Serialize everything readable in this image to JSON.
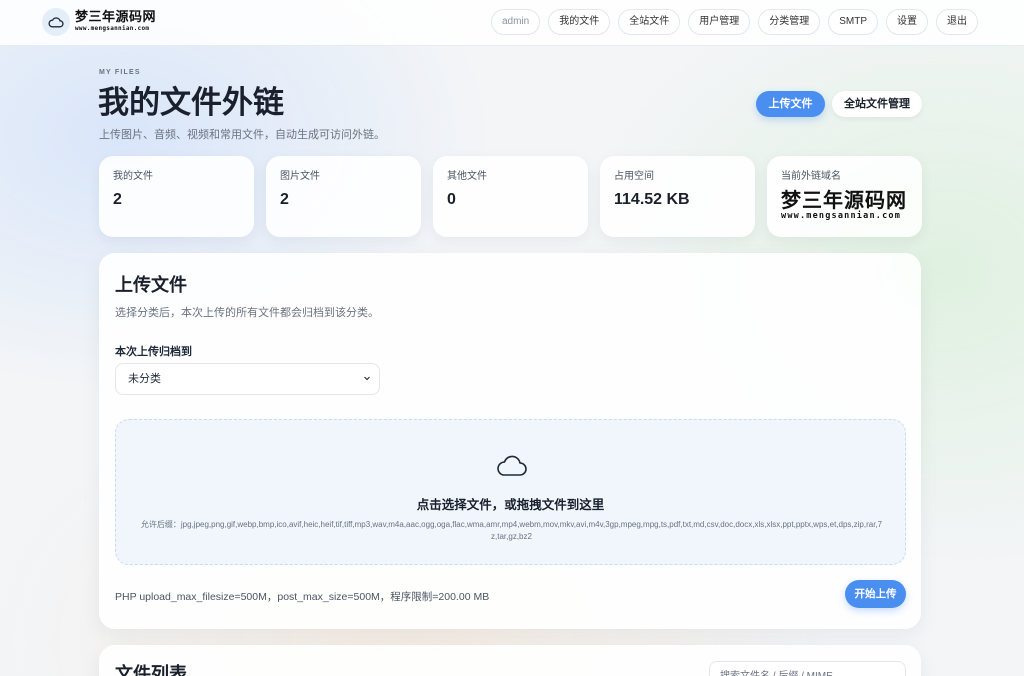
{
  "topbar": {
    "brand_cn": "梦三年源码网",
    "brand_url": "www.mengsannian.com",
    "nav": [
      {
        "label": "admin",
        "name": "nav-user-admin"
      },
      {
        "label": "我的文件",
        "name": "nav-my-files"
      },
      {
        "label": "全站文件",
        "name": "nav-all-files"
      },
      {
        "label": "用户管理",
        "name": "nav-user-management"
      },
      {
        "label": "分类管理",
        "name": "nav-category-management"
      },
      {
        "label": "SMTP",
        "name": "nav-smtp"
      },
      {
        "label": "设置",
        "name": "nav-settings"
      },
      {
        "label": "退出",
        "name": "nav-logout"
      }
    ]
  },
  "header": {
    "eyebrow": "MY FILES",
    "title": "我的文件外链",
    "subtitle": "上传图片、音频、视频和常用文件，自动生成可访问外链。",
    "upload_label": "上传文件",
    "manage_all_label": "全站文件管理"
  },
  "stats": [
    {
      "label": "我的文件",
      "value": "2"
    },
    {
      "label": "图片文件",
      "value": "2"
    },
    {
      "label": "其他文件",
      "value": "0"
    },
    {
      "label": "占用空间",
      "value": "114.52 KB"
    },
    {
      "label": "当前外链域名",
      "brand_cn": "梦三年源码网",
      "brand_url": "www.mengsannian.com"
    }
  ],
  "upload": {
    "title": "上传文件",
    "description": "选择分类后，本次上传的所有文件都会归档到该分类。",
    "category_label": "本次上传归档到",
    "category_selected": "未分类",
    "dropzone_title": "点击选择文件，或拖拽文件到这里",
    "allowed_ext": "允许后缀：jpg,jpeg,png,gif,webp,bmp,ico,avif,heic,heif,tif,tiff,mp3,wav,m4a,aac,ogg,oga,flac,wma,amr,mp4,webm,mov,mkv,avi,m4v,3gp,mpeg,mpg,ts,pdf,txt,md,csv,doc,docx,xls,xlsx,ppt,pptx,wps,et,dps,zip,rar,7z,tar,gz,bz2",
    "limits": "PHP upload_max_filesize=500M，post_max_size=500M，程序限制=200.00 MB",
    "start_label": "开始上传"
  },
  "file_list": {
    "title": "文件列表",
    "search_placeholder": "搜索文件名 / 后缀 / MIME"
  },
  "colors": {
    "accent": "#4a8ef0",
    "dropzone_bg": "#f1f6fd",
    "dropzone_border": "#c9dbf2"
  },
  "icons": {
    "logo": "cloud-icon",
    "dropzone": "cloud-upload-icon",
    "select": "chevron-down-icon"
  }
}
